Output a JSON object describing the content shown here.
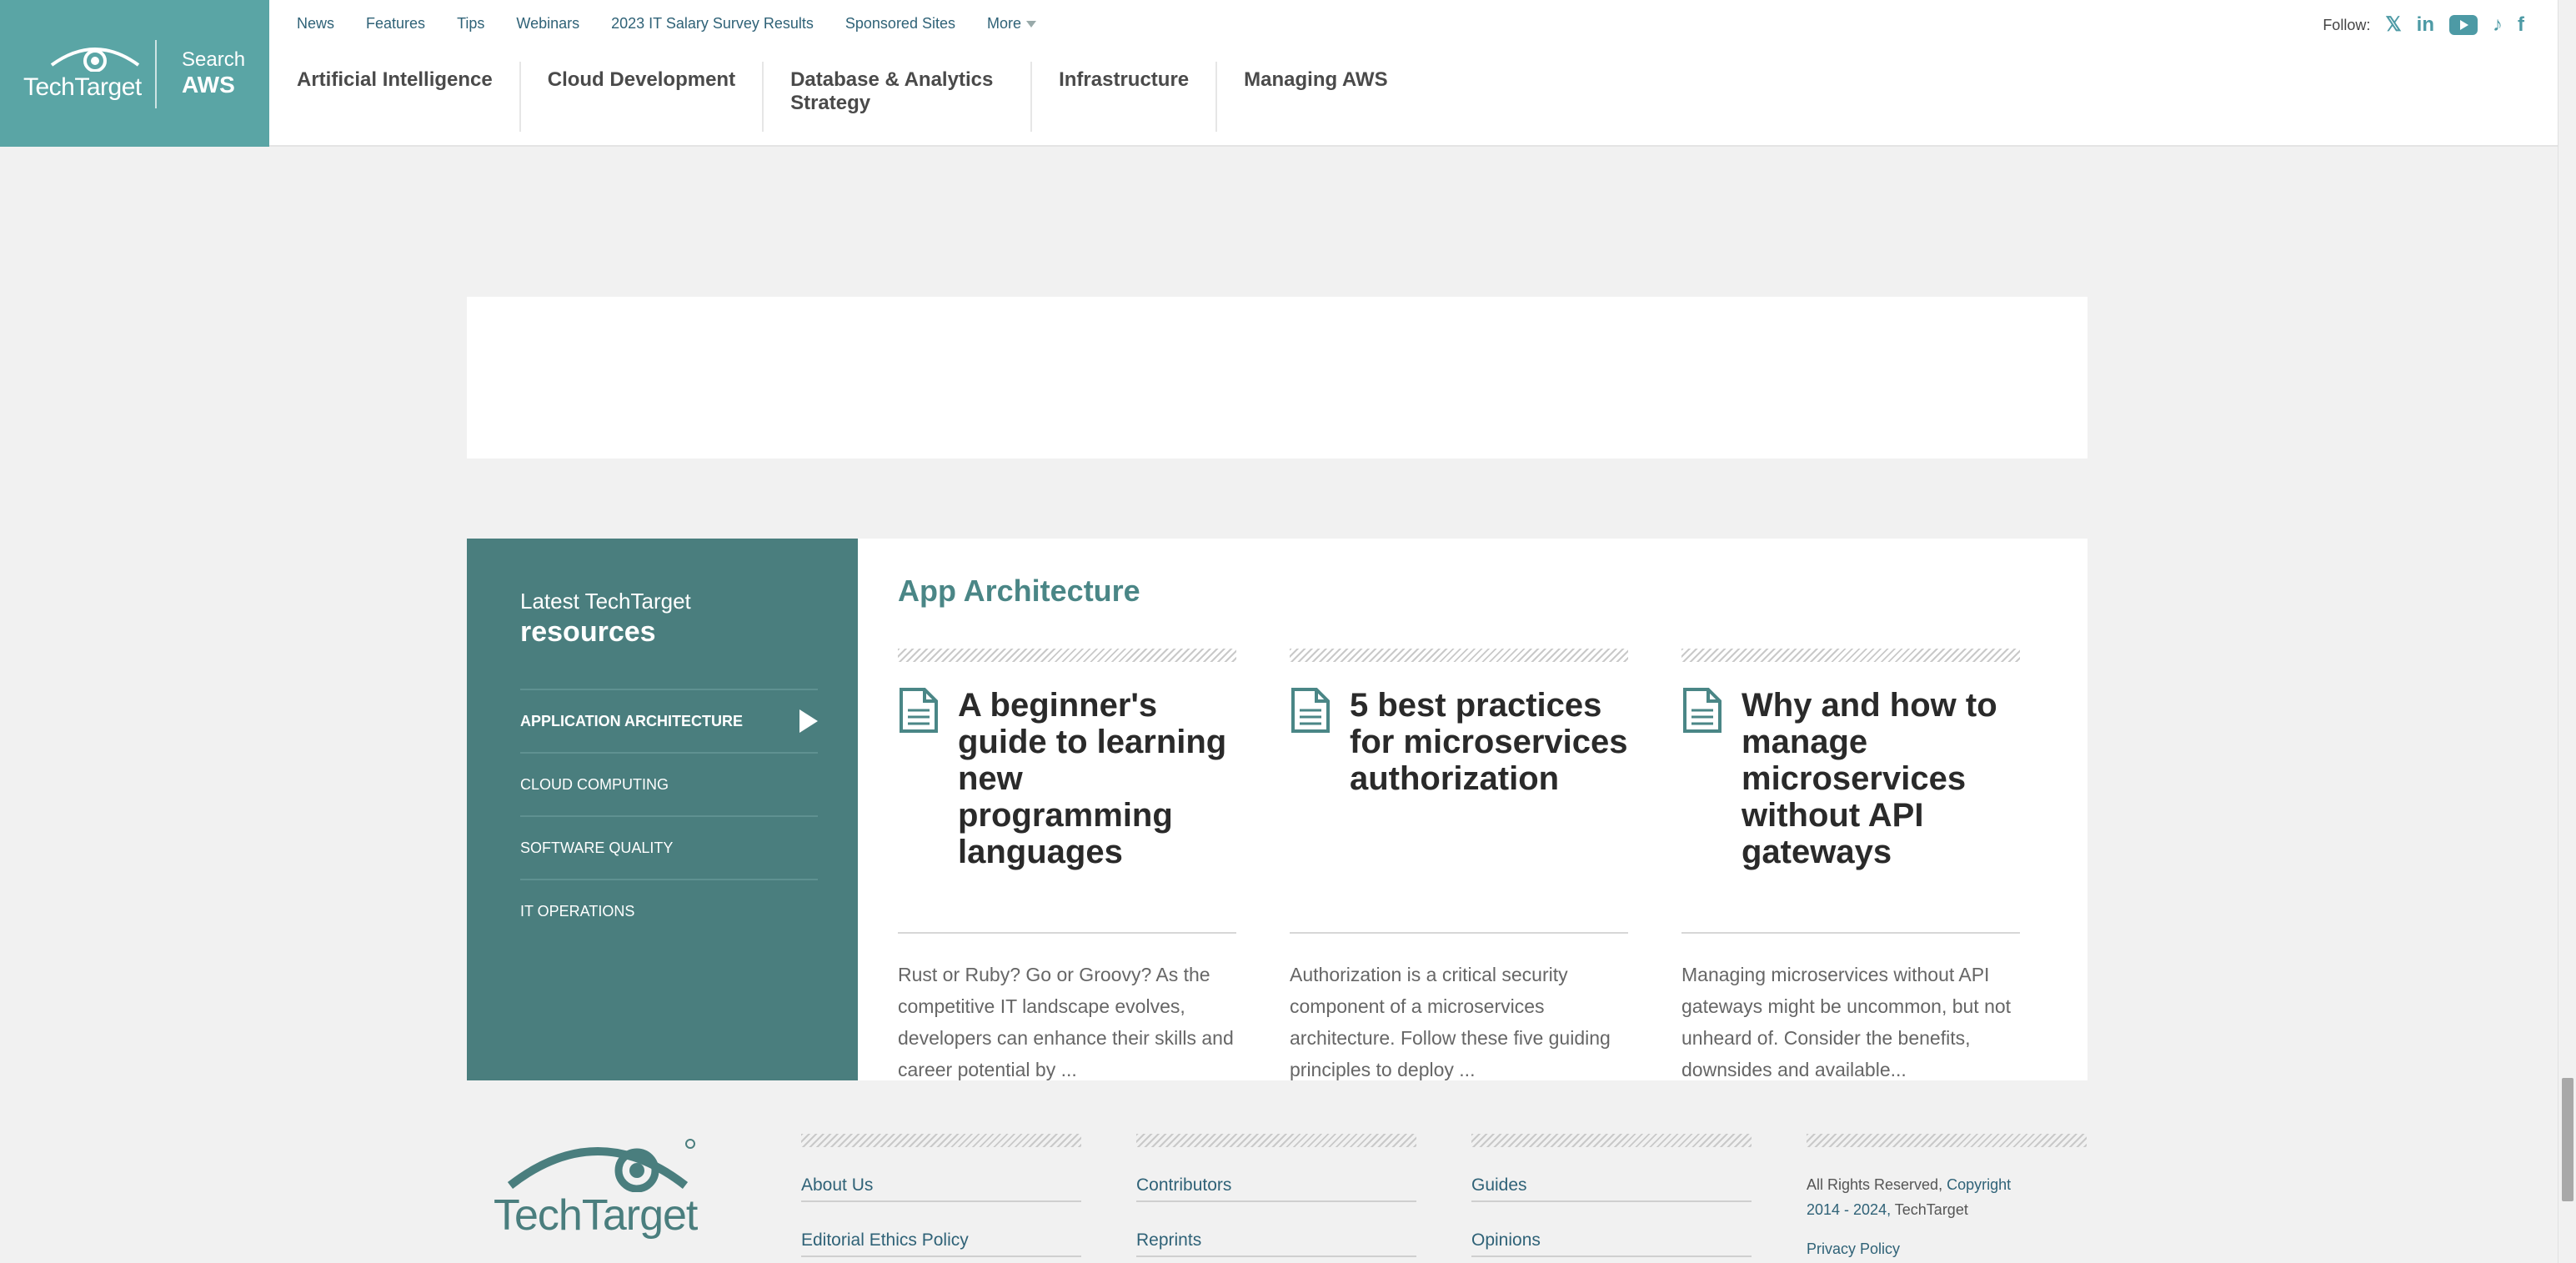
{
  "header": {
    "logo": {
      "brand": "TechTarget",
      "search_word": "Search",
      "site_word": "AWS"
    },
    "top_links": [
      "News",
      "Features",
      "Tips",
      "Webinars",
      "2023 IT Salary Survey Results",
      "Sponsored Sites"
    ],
    "more_label": "More",
    "nav": [
      "Artificial Intelligence",
      "Cloud Development",
      "Database & Analytics Strategy",
      "Infrastructure",
      "Managing AWS"
    ],
    "follow_label": "Follow:",
    "social": [
      "x-icon",
      "linkedin-icon",
      "youtube-icon",
      "tiktok-icon",
      "facebook-icon"
    ]
  },
  "resources": {
    "latest": "Latest TechTarget",
    "resources_word": "resources",
    "categories": [
      "APPLICATION ARCHITECTURE",
      "CLOUD COMPUTING",
      "SOFTWARE QUALITY",
      "IT OPERATIONS"
    ],
    "active_category": "APPLICATION ARCHITECTURE",
    "section_title": "App Architecture",
    "cards": [
      {
        "title": "A beginner's guide to learning new programming languages",
        "excerpt": "Rust or Ruby? Go or Groovy? As the competitive IT landscape evolves, developers can enhance their skills and career potential by ..."
      },
      {
        "title": "5 best practices for microservices authorization",
        "excerpt": "Authorization is a critical security component of a microservices architecture. Follow these five guiding principles to deploy ..."
      },
      {
        "title": "Why and how to manage microservices without API gateways",
        "excerpt": "Managing microservices without API gateways might be uncommon, but not unheard of. Consider the benefits, downsides and available..."
      }
    ]
  },
  "footer": {
    "brand": "TechTarget",
    "col1": [
      "About Us",
      "Editorial Ethics Policy"
    ],
    "col2": [
      "Contributors",
      "Reprints"
    ],
    "col3": [
      "Guides",
      "Opinions"
    ],
    "rights_prefix": "All Rights Reserved,",
    "copyright_word": "Copyright",
    "copyright_years": "2014 - 2024,",
    "copyright_owner": "TechTarget",
    "privacy": "Privacy Policy"
  },
  "colors": {
    "teal": "#5aa5a5",
    "dark_teal": "#4a7e7e",
    "link": "#2f6277"
  }
}
